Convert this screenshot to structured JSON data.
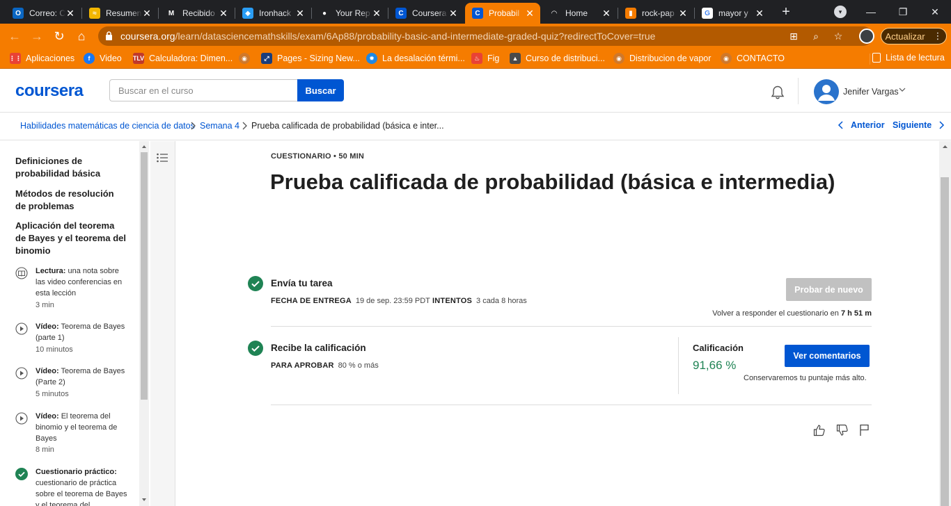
{
  "browser": {
    "tabs": [
      {
        "title": "Correo: C",
        "fav": "O",
        "fav_color": "#0a66c2"
      },
      {
        "title": "Resumen",
        "fav": "≈",
        "fav_color": "#f2b600"
      },
      {
        "title": "Recibido",
        "fav": "M",
        "fav_color": "#202124"
      },
      {
        "title": "Ironhack",
        "fav": "◆",
        "fav_color": "#2a9df4"
      },
      {
        "title": "Your Rep",
        "fav": "●",
        "fav_color": "#202124"
      },
      {
        "title": "Coursera",
        "fav": "C",
        "fav_color": "#0056d2"
      },
      {
        "title": "Probabil",
        "fav": "C",
        "fav_color": "#0056d2"
      },
      {
        "title": "Home",
        "fav": "◠",
        "fav_color": "#202124"
      },
      {
        "title": "rock-pap",
        "fav": "▮",
        "fav_color": "#f57c00"
      },
      {
        "title": "mayor y",
        "fav": "G",
        "fav_color": "#ffffff"
      }
    ],
    "active_tab_index": 6,
    "url_host": "coursera.org",
    "url_path": "/learn/datasciencemathskills/exam/6Ap88/probability-basic-and-intermediate-graded-quiz?redirectToCover=true",
    "update_label": "Actualizar",
    "accent": "#f57c00",
    "bookmarks": [
      {
        "label": "Aplicaciones",
        "icon": "apps-grid-icon",
        "color": "#e94235"
      },
      {
        "label": "Video",
        "icon": "facebook-icon",
        "color": "#1877f2"
      },
      {
        "label": "Calculadora: Dimen...",
        "icon": "tlv-icon",
        "color": "#c0392b"
      },
      {
        "label": "",
        "icon": "globe-icon",
        "color": "#d0782a"
      },
      {
        "label": "Pages - Sizing New...",
        "icon": "pages-icon",
        "color": "#1a3d7c"
      },
      {
        "label": "La desalación térmi...",
        "icon": "gear-icon",
        "color": "#1e88e5"
      },
      {
        "label": "Fig",
        "icon": "fig-icon",
        "color": "#e94235"
      },
      {
        "label": "Curso de distribuci...",
        "icon": "wolf-icon",
        "color": "#4a4a4a"
      },
      {
        "label": "Distribucion de vapor",
        "icon": "globe-icon",
        "color": "#d0782a"
      },
      {
        "label": "CONTACTO",
        "icon": "globe-icon",
        "color": "#d0782a"
      }
    ],
    "reading_list_label": "Lista de lectura"
  },
  "header": {
    "logo": "coursera",
    "search_placeholder": "Buscar en el curso",
    "search_button": "Buscar",
    "user_name": "Jenifer Vargas"
  },
  "breadcrumb": {
    "items": [
      "Habilidades matemáticas de ciencia de datos",
      "Semana 4",
      "Prueba calificada de probabilidad (básica e inter..."
    ],
    "prev_label": "Anterior",
    "next_label": "Siguiente"
  },
  "sidebar": {
    "sections": [
      "Definiciones de probabilidad básica",
      "Métodos de resolución de problemas",
      "Aplicación del teorema de Bayes y el teorema del binomio"
    ],
    "lessons": [
      {
        "type": "Lectura:",
        "title": "una nota sobre las video conferencias en esta lección",
        "duration": "3 min",
        "icon": "book-icon"
      },
      {
        "type": "Vídeo:",
        "title": "Teorema de Bayes (parte 1)",
        "duration": "10 minutos",
        "icon": "play-circle-icon"
      },
      {
        "type": "Vídeo:",
        "title": "Teorema de Bayes (Parte 2)",
        "duration": "5 minutos",
        "icon": "play-circle-icon"
      },
      {
        "type": "Vídeo:",
        "title": "El teorema del binomio y el teorema de Bayes",
        "duration": "8 min",
        "icon": "play-circle-icon"
      },
      {
        "type": "Cuestionario práctico:",
        "title": "cuestionario de práctica sobre el teorema de Bayes y el teorema del",
        "duration": "",
        "icon": "check-circle-icon"
      }
    ]
  },
  "main": {
    "kicker_type": "CUESTIONARIO",
    "kicker_time": "50 MIN",
    "title": "Prueba calificada de probabilidad (básica e intermedia)",
    "submit": {
      "title": "Envía tu tarea",
      "due_label": "FECHA DE ENTREGA",
      "due_value": "19 de sep. 23:59 PDT",
      "attempts_label": "INTENTOS",
      "attempts_value": "3 cada 8 horas",
      "retry_button": "Probar de nuevo",
      "retake_text": "Volver a responder el cuestionario en",
      "retake_time": "7 h 51 m"
    },
    "grade": {
      "title": "Recibe la calificación",
      "pass_label": "PARA APROBAR",
      "pass_value": "80 % o más",
      "label": "Calificación",
      "value": "91,66 %",
      "feedback_button": "Ver comentarios",
      "keep_note": "Conservaremos tu puntaje más alto."
    },
    "colors": {
      "primary": "#0056d2",
      "success": "#1f8354",
      "disabled": "#c1c1c1"
    }
  }
}
